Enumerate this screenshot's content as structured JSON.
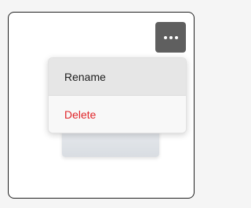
{
  "menu": {
    "items": [
      {
        "label": "Rename"
      },
      {
        "label": "Delete"
      }
    ]
  },
  "icons": {
    "more": "more-horizontal-icon"
  },
  "colors": {
    "delete_text": "#e0262a",
    "more_button_bg": "#5f5f5f",
    "highlight_bg": "#e6e6e6"
  }
}
